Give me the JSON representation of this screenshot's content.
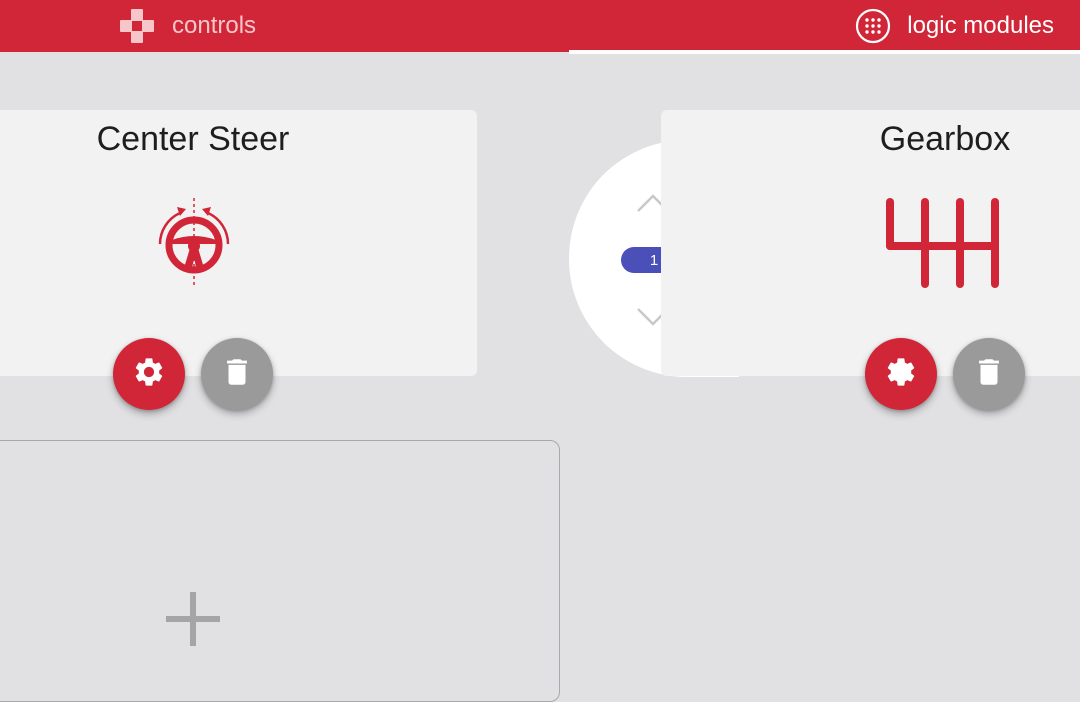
{
  "header": {
    "tabs": [
      {
        "label": "controls",
        "icon": "gamepad-icon",
        "active": false
      },
      {
        "label": "logic modules",
        "icon": "logic-grid-icon",
        "active": true
      }
    ]
  },
  "modules": [
    {
      "title": "Center Steer",
      "icon": "steering-wheel-icon",
      "settings_icon": "gear-icon",
      "delete_icon": "trash-icon"
    },
    {
      "title": "Gearbox",
      "icon": "gearbox-icon",
      "settings_icon": "gear-icon",
      "delete_icon": "trash-icon"
    }
  ],
  "order_selector": {
    "value": "1",
    "up_icon": "chevron-up-icon",
    "down_icon": "chevron-down-icon"
  },
  "add_module": {
    "icon": "plus-icon"
  },
  "colors": {
    "accent": "#d12637",
    "background": "#e1e1e4",
    "card": "#f2f2f2",
    "badge": "#4b4fb8",
    "secondary_button": "#9a9a9a"
  }
}
